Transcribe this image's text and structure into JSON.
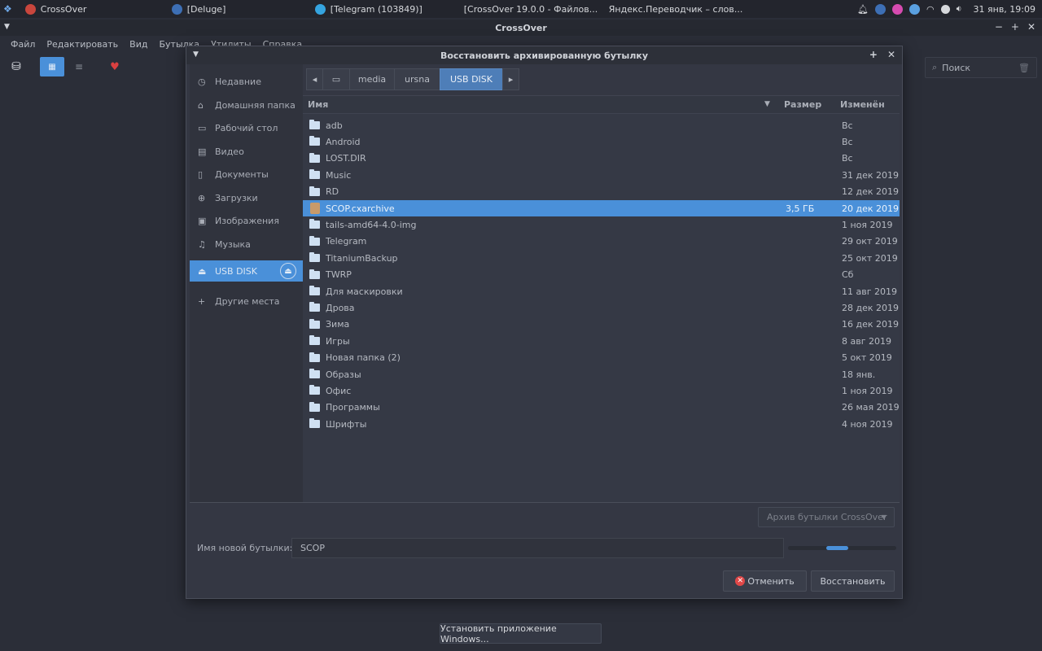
{
  "taskbar": {
    "tasks": [
      {
        "label": "CrossOver",
        "icon": "crossover-icon"
      },
      {
        "label": "[Deluge]",
        "icon": "deluge-icon"
      },
      {
        "label": "[Telegram (103849)]",
        "icon": "telegram-icon"
      },
      {
        "label": "[CrossOver 19.0.0 - Файлов...",
        "icon": "folder-icon"
      },
      {
        "label": "Яндекс.Переводчик – слов...",
        "icon": "browser-icon"
      }
    ],
    "clock": "31 янв, 19:09"
  },
  "window": {
    "title": "CrossOver",
    "menu": [
      "Файл",
      "Редактировать",
      "Вид",
      "Бутылка",
      "Утилиты",
      "Справка"
    ],
    "search_placeholder": "Поиск",
    "install_button": "Установить приложение Windows..."
  },
  "dialog": {
    "title": "Восстановить архивированную бутылку",
    "places": [
      {
        "label": "Недавние",
        "icon": "recent-icon"
      },
      {
        "label": "Домашняя папка",
        "icon": "home-icon"
      },
      {
        "label": "Рабочий стол",
        "icon": "desktop-icon"
      },
      {
        "label": "Видео",
        "icon": "video-icon"
      },
      {
        "label": "Документы",
        "icon": "document-icon"
      },
      {
        "label": "Загрузки",
        "icon": "download-icon"
      },
      {
        "label": "Изображения",
        "icon": "image-icon"
      },
      {
        "label": "Музыка",
        "icon": "music-icon"
      },
      {
        "label": "USB DISK",
        "icon": "usb-drive-icon"
      },
      {
        "label": "Другие места",
        "icon": "plus-icon"
      }
    ],
    "path": [
      "media",
      "ursna",
      "USB DISK"
    ],
    "columns": {
      "name": "Имя",
      "size": "Размер",
      "modified": "Изменён"
    },
    "files": [
      {
        "name": "adb",
        "size": "",
        "modified": "Вс",
        "type": "folder"
      },
      {
        "name": "Android",
        "size": "",
        "modified": "Вс",
        "type": "folder"
      },
      {
        "name": "LOST.DIR",
        "size": "",
        "modified": "Вс",
        "type": "folder"
      },
      {
        "name": "Music",
        "size": "",
        "modified": "31 дек 2019",
        "type": "folder"
      },
      {
        "name": "RD",
        "size": "",
        "modified": "12 дек 2019",
        "type": "folder"
      },
      {
        "name": "SCOP.cxarchive",
        "size": "3,5 ГБ",
        "modified": "20 дек 2019",
        "type": "archive"
      },
      {
        "name": "tails-amd64-4.0-img",
        "size": "",
        "modified": "1 ноя 2019",
        "type": "folder"
      },
      {
        "name": "Telegram",
        "size": "",
        "modified": "29 окт 2019",
        "type": "folder"
      },
      {
        "name": "TitaniumBackup",
        "size": "",
        "modified": "25 окт 2019",
        "type": "folder"
      },
      {
        "name": "TWRP",
        "size": "",
        "modified": "Сб",
        "type": "folder"
      },
      {
        "name": "Для маскировки",
        "size": "",
        "modified": "11 авг 2019",
        "type": "folder"
      },
      {
        "name": "Дрова",
        "size": "",
        "modified": "28 дек 2019",
        "type": "folder"
      },
      {
        "name": "Зима",
        "size": "",
        "modified": "16 дек 2019",
        "type": "folder"
      },
      {
        "name": "Игры",
        "size": "",
        "modified": "8 авг 2019",
        "type": "folder"
      },
      {
        "name": "Новая папка (2)",
        "size": "",
        "modified": "5 окт 2019",
        "type": "folder"
      },
      {
        "name": "Образы",
        "size": "",
        "modified": "18 янв.",
        "type": "folder"
      },
      {
        "name": "Офис",
        "size": "",
        "modified": "1 ноя 2019",
        "type": "folder"
      },
      {
        "name": "Программы",
        "size": "",
        "modified": "26 мая 2019",
        "type": "folder"
      },
      {
        "name": "Шрифты",
        "size": "",
        "modified": "4 ноя 2019",
        "type": "folder"
      }
    ],
    "filter": "Архив бутылки CrossOver",
    "name_label": "Имя новой бутылки:",
    "name_value": "SCOP",
    "progress": 0.3,
    "cancel_button": "Отменить",
    "restore_button": "Восстановить"
  }
}
